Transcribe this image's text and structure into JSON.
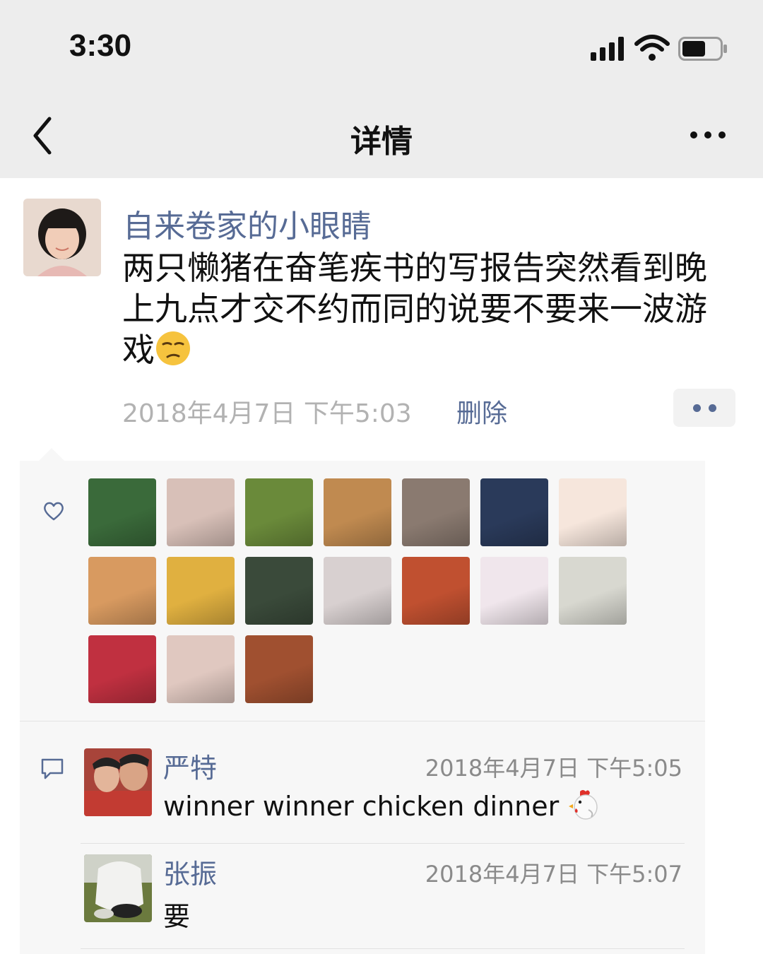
{
  "status": {
    "time": "3:30"
  },
  "nav": {
    "title": "详情",
    "back_icon": "chevron-left-icon",
    "more_icon": "more-icon"
  },
  "post": {
    "author": "自来卷家的小眼睛",
    "text": "两只懒猪在奋笔疾书的写报告突然看到晚上九点才交不约而同的说要不要来一波游戏",
    "emoji": "unamused-face-emoji",
    "time": "2018年4月7日 下午5:03",
    "delete_label": "删除"
  },
  "likes": {
    "icon": "heart-icon",
    "avatar_colors": [
      "#3a6a3a",
      "#d8c0b8",
      "#6a8a3a",
      "#c08a50",
      "#8a7a70",
      "#2a3a5a",
      "#f6e6dc",
      "#d89a60",
      "#e0b040",
      "#3a4a3a",
      "#d8d0d0",
      "#c05030",
      "#f0e6ec",
      "#d8d8d0",
      "#c03040",
      "#e0c8c0",
      "#a05030"
    ]
  },
  "comments": {
    "icon": "comment-icon",
    "items": [
      {
        "name": "严特",
        "time": "2018年4月7日 下午5:05",
        "text": "winner winner chicken dinner",
        "emoji": "chicken-emoji"
      },
      {
        "name": "张振",
        "time": "2018年4月7日 下午5:07",
        "text": "要"
      }
    ]
  }
}
